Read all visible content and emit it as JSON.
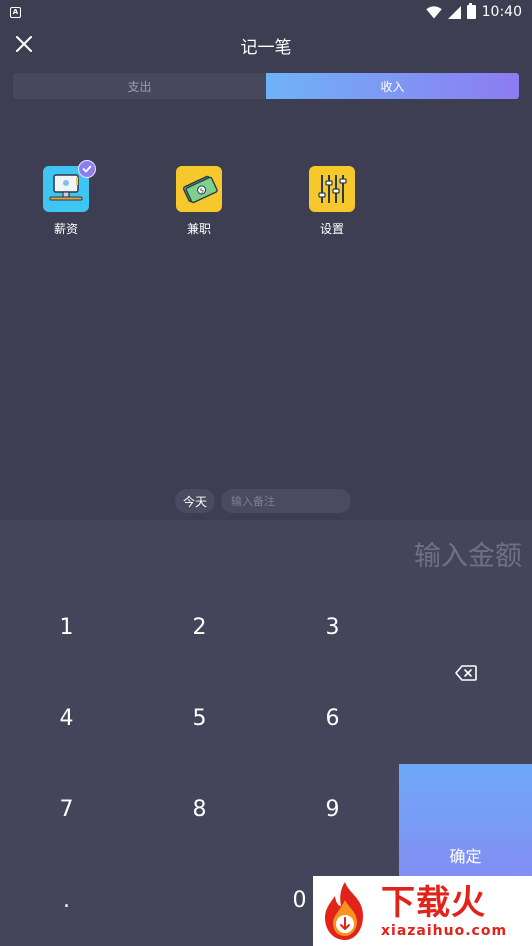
{
  "status_bar": {
    "time": "10:40",
    "notification_icon": "android-notification-icon",
    "wifi_icon": "wifi-icon",
    "signal_icon": "signal-icon",
    "battery_icon": "battery-charging-icon"
  },
  "header": {
    "title": "记一笔",
    "close_icon": "close-icon"
  },
  "tabs": [
    {
      "label": "支出",
      "active": false
    },
    {
      "label": "收入",
      "active": true
    }
  ],
  "categories": [
    {
      "label": "薪资",
      "icon": "salary-monitor-icon",
      "selected": true,
      "color": "#3ec5f2"
    },
    {
      "label": "兼职",
      "icon": "cash-stack-icon",
      "selected": false,
      "color": "#f7c82c"
    },
    {
      "label": "设置",
      "icon": "sliders-settings-icon",
      "selected": false,
      "color": "#f7c82c"
    }
  ],
  "note": {
    "date_label": "今天",
    "placeholder": "输入备注"
  },
  "amount": {
    "placeholder": "输入金额"
  },
  "keypad": {
    "keys": [
      "1",
      "2",
      "3",
      "4",
      "5",
      "6",
      "7",
      "8",
      "9",
      ".",
      "0"
    ],
    "backspace_icon": "backspace-icon",
    "confirm_label": "确定"
  },
  "watermark": {
    "brand": "下载火",
    "url": "xiazaihuo.com",
    "icon": "flame-logo-icon"
  },
  "colors": {
    "background": "#3d3e52",
    "keypad_background": "#44455a",
    "accent_start": "#6fb3f7",
    "accent_end": "#8d7cf2",
    "watermark_red": "#e2231a"
  }
}
